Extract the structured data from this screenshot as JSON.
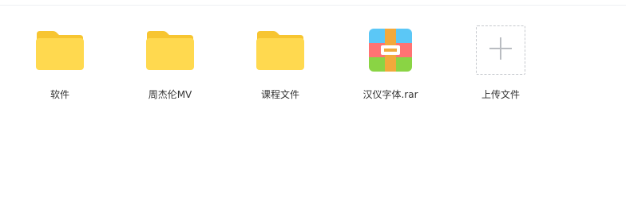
{
  "files": [
    {
      "name": "软件",
      "type": "folder"
    },
    {
      "name": "周杰伦MV",
      "type": "folder"
    },
    {
      "name": "课程文件",
      "type": "folder"
    },
    {
      "name": "汉仪字体.rar",
      "type": "rar-archive"
    }
  ],
  "upload": {
    "label": "上传文件",
    "icon": "plus-icon"
  },
  "colors": {
    "folder_body": "#ffd94f",
    "folder_tab": "#f7c531",
    "rar_top": "#5bc7f6",
    "rar_middle": "#ff7373",
    "rar_bottom": "#8ad444",
    "rar_strap": "#f2a93b",
    "upload_border": "#c6c9ce",
    "plus": "#b9bcc1",
    "label_text": "#333333"
  }
}
